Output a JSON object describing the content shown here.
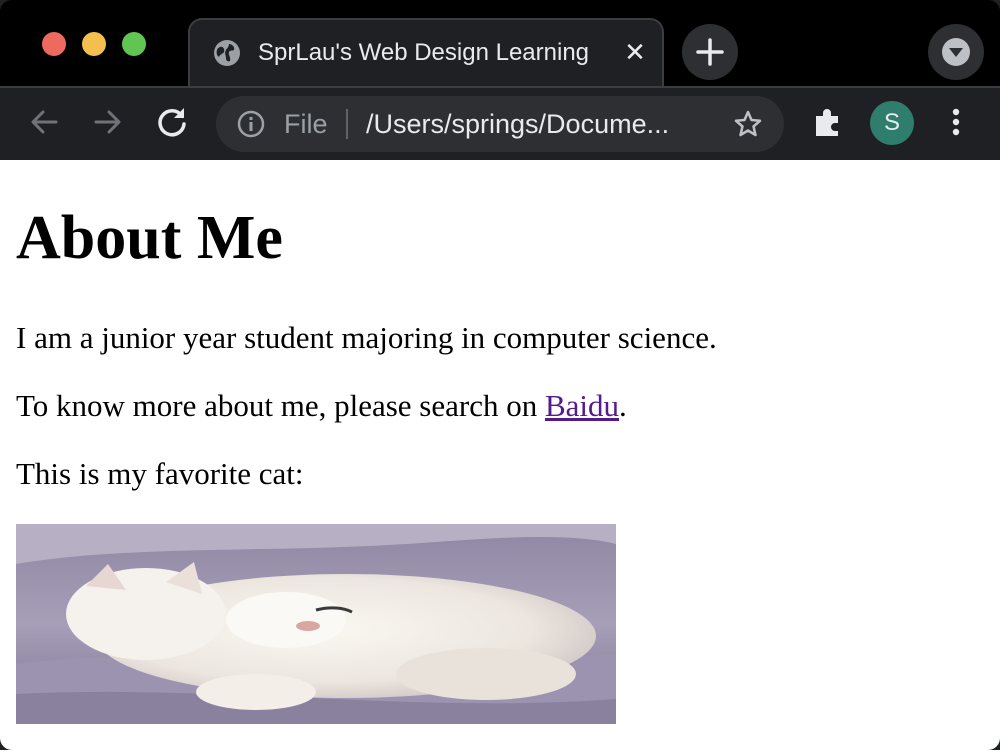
{
  "browser": {
    "tab_title": "SprLau's Web Design Learning",
    "address_scheme_label": "File",
    "address_url": "/Users/springs/Docume...",
    "profile_initial": "S",
    "icons": [
      "globe-icon",
      "close-icon",
      "plus-icon",
      "dropdown-icon",
      "back-icon",
      "forward-icon",
      "reload-icon",
      "info-icon",
      "star-icon",
      "extensions-icon",
      "more-icon"
    ]
  },
  "page": {
    "heading": "About Me",
    "intro": "I am a junior year student majoring in computer science.",
    "search_prefix": "To know more about me, please search on ",
    "search_link": "Baidu",
    "search_suffix": ".",
    "cat_caption": "This is my favorite cat:"
  },
  "colors": {
    "link_visited": "#551a8b",
    "traffic_red": "#ed6a5e",
    "traffic_yellow": "#f4bf4f",
    "traffic_green": "#61c554",
    "avatar_bg": "#2f7d6d"
  }
}
